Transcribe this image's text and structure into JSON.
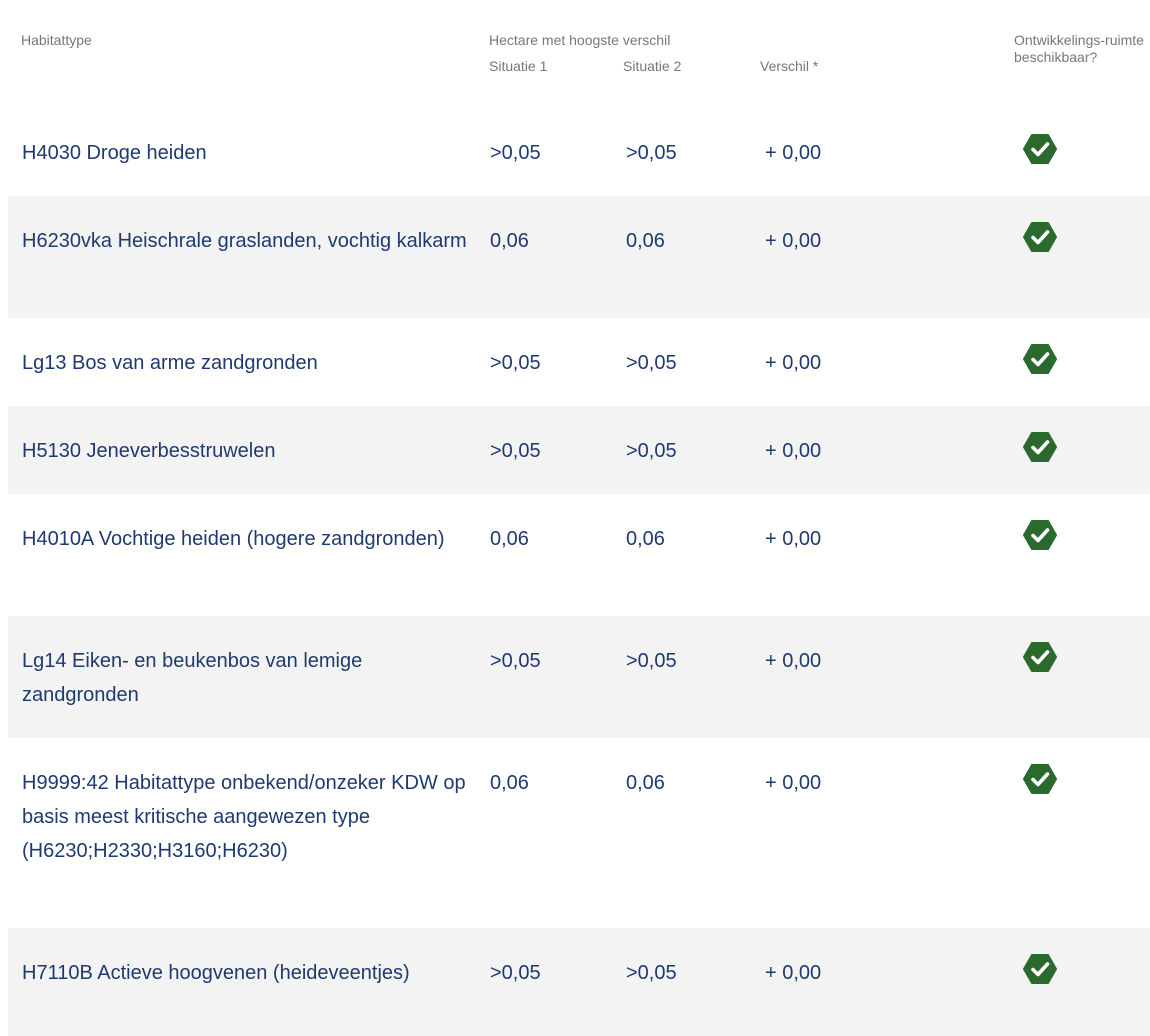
{
  "header": {
    "habitattype": "Habitattype",
    "hectare": "Hectare met hoogste verschil",
    "situatie1": "Situatie 1",
    "situatie2": "Situatie 2",
    "verschil": "Verschil *",
    "ontwikkelingsruimte": "Ontwikkelings-ruimte beschikbaar?"
  },
  "rows": [
    {
      "name": "H4030 Droge heiden",
      "s1": ">0,05",
      "s2": ">0,05",
      "verschil": "+ 0,00",
      "available": true,
      "icon": "check-icon"
    },
    {
      "name": "H6230vka Heischrale graslanden, vochtig kalkarm",
      "s1": "0,06",
      "s2": "0,06",
      "verschil": "+ 0,00",
      "available": true,
      "icon": "check-icon"
    },
    {
      "name": "Lg13 Bos van arme zandgronden",
      "s1": ">0,05",
      "s2": ">0,05",
      "verschil": "+ 0,00",
      "available": true,
      "icon": "check-icon"
    },
    {
      "name": "H5130 Jeneverbesstruwelen",
      "s1": ">0,05",
      "s2": ">0,05",
      "verschil": "+ 0,00",
      "available": true,
      "icon": "check-icon"
    },
    {
      "name": "H4010A Vochtige heiden (hogere zandgronden)",
      "s1": "0,06",
      "s2": "0,06",
      "verschil": "+ 0,00",
      "available": true,
      "icon": "check-icon"
    },
    {
      "name": "Lg14 Eiken- en beukenbos van lemige zandgronden",
      "s1": ">0,05",
      "s2": ">0,05",
      "verschil": "+ 0,00",
      "available": true,
      "icon": "check-icon"
    },
    {
      "name": "H9999:42 Habitattype onbekend/onzeker KDW op basis meest kritische aangewezen type (H6230;H2330;H3160;H6230)",
      "s1": "0,06",
      "s2": "0,06",
      "verschil": "+ 0,00",
      "available": true,
      "icon": "check-icon"
    },
    {
      "name": "H7110B Actieve hoogvenen (heideveentjes)",
      "s1": ">0,05",
      "s2": ">0,05",
      "verschil": "+ 0,00",
      "available": true,
      "icon": "check-icon"
    }
  ],
  "colors": {
    "check": "#2b6a2d",
    "text": "#1e3a70",
    "header": "#777777",
    "stripe": "#f3f3f3"
  }
}
